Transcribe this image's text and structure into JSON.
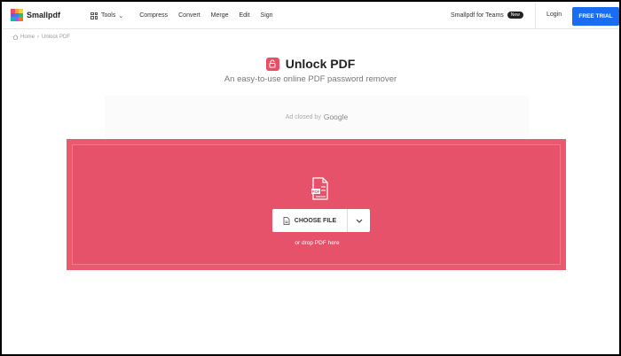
{
  "header": {
    "brand": "Smallpdf",
    "nav": [
      "Tools",
      "Compress",
      "Convert",
      "Merge",
      "Edit",
      "Sign"
    ],
    "teams_label": "Smallpdf for Teams",
    "new_badge": "New",
    "login": "Login",
    "trial": "FREE TRIAL"
  },
  "breadcrumb": {
    "home": "Home",
    "sep": "›",
    "current": "Unlock PDF"
  },
  "hero": {
    "title": "Unlock PDF",
    "subtitle": "An easy-to-use online PDF password remover"
  },
  "ad": {
    "text": "Ad closed by",
    "brand": "Google"
  },
  "dropzone": {
    "button": "CHOOSE FILE",
    "hint": "or drop PDF here",
    "pdf_label": "PDF"
  },
  "colors": {
    "accent": "#e95a6e",
    "trial": "#1a6cf0"
  }
}
